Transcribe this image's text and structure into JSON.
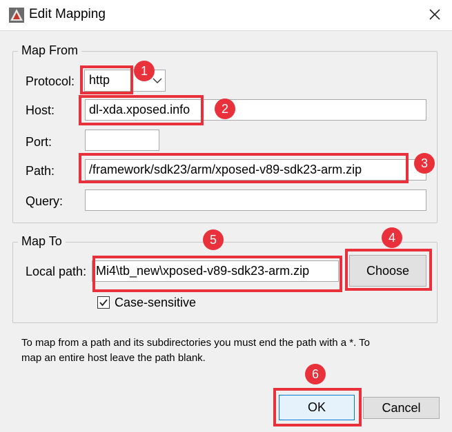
{
  "window": {
    "title": "Edit Mapping"
  },
  "map_from": {
    "group_title": "Map From",
    "protocol_label": "Protocol:",
    "protocol_value": "http",
    "host_label": "Host:",
    "host_value": "dl-xda.xposed.info",
    "port_label": "Port:",
    "port_value": "",
    "path_label": "Path:",
    "path_value": "/framework/sdk23/arm/xposed-v89-sdk23-arm.zip",
    "query_label": "Query:",
    "query_value": ""
  },
  "map_to": {
    "group_title": "Map To",
    "local_path_label": "Local path:",
    "local_path_value": "Mi4\\tb_new\\xposed-v89-sdk23-arm.zip",
    "choose_label": "Choose",
    "case_sensitive_label": "Case-sensitive",
    "case_sensitive_checked": true
  },
  "hint": {
    "line1": "To map from a path and its subdirectories you must end the path with a *. To",
    "line2": "map an entire host leave the path blank."
  },
  "buttons": {
    "ok_label": "OK",
    "cancel_label": "Cancel"
  },
  "callouts": [
    "1",
    "2",
    "3",
    "4",
    "5",
    "6"
  ],
  "colors": {
    "callout": "#e8313a",
    "focus": "#0078d7"
  }
}
